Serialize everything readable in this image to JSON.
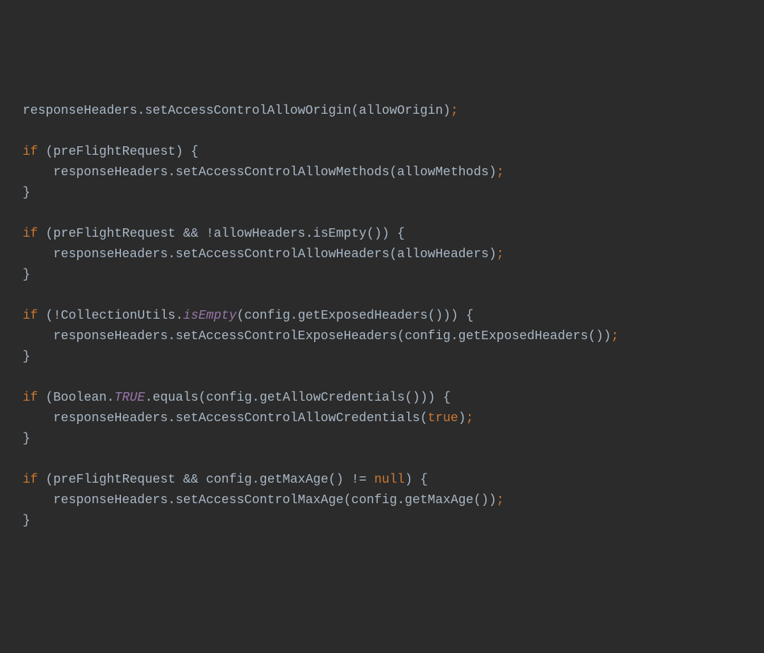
{
  "code": {
    "l1": {
      "responseHeaders": "responseHeaders",
      "dot1": ".",
      "setAccessControlAllowOrigin": "setAccessControlAllowOrigin",
      "op": "(",
      "allowOrigin": "allowOrigin",
      "cp": ")",
      "sc": ";"
    },
    "l3": {
      "if": "if",
      "sp": " ",
      "op": "(",
      "preFlightRequest": "preFlightRequest",
      "cp": ")",
      "sp2": " ",
      "ob": "{"
    },
    "l4": {
      "indent": "    ",
      "responseHeaders": "responseHeaders",
      "dot": ".",
      "setAccessControlAllowMethods": "setAccessControlAllowMethods",
      "op": "(",
      "allowMethods": "allowMethods",
      "cp": ")",
      "sc": ";"
    },
    "l5": {
      "cb": "}"
    },
    "l7": {
      "if": "if",
      "sp": " ",
      "op": "(",
      "preFlightRequest": "preFlightRequest",
      "sp2": " ",
      "andand": "&&",
      "sp3": " ",
      "bang": "!",
      "allowHeaders": "allowHeaders",
      "dot": ".",
      "isEmpty": "isEmpty",
      "op2": "(",
      "cp2": ")",
      "cp": ")",
      "sp4": " ",
      "ob": "{"
    },
    "l8": {
      "indent": "    ",
      "responseHeaders": "responseHeaders",
      "dot": ".",
      "setAccessControlAllowHeaders": "setAccessControlAllowHeaders",
      "op": "(",
      "allowHeaders": "allowHeaders",
      "cp": ")",
      "sc": ";"
    },
    "l9": {
      "cb": "}"
    },
    "l11": {
      "if": "if",
      "sp": " ",
      "op": "(",
      "bang": "!",
      "CollectionUtils": "CollectionUtils",
      "dot": ".",
      "isEmpty": "isEmpty",
      "op2": "(",
      "config": "config",
      "dot2": ".",
      "getExposedHeaders": "getExposedHeaders",
      "op3": "(",
      "cp3": ")",
      "cp2": ")",
      "cp": ")",
      "sp2": " ",
      "ob": "{"
    },
    "l12": {
      "indent": "    ",
      "responseHeaders": "responseHeaders",
      "dot": ".",
      "setAccessControlExposeHeaders": "setAccessControlExposeHeaders",
      "op": "(",
      "config": "config",
      "dot2": ".",
      "getExposedHeaders": "getExposedHeaders",
      "op2": "(",
      "cp2": ")",
      "cp": ")",
      "sc": ";"
    },
    "l13": {
      "cb": "}"
    },
    "l15": {
      "if": "if",
      "sp": " ",
      "op": "(",
      "Boolean": "Boolean",
      "dot": ".",
      "TRUE": "TRUE",
      "dot2": ".",
      "equals": "equals",
      "op2": "(",
      "config": "config",
      "dot3": ".",
      "getAllowCredentials": "getAllowCredentials",
      "op3": "(",
      "cp3": ")",
      "cp2": ")",
      "cp": ")",
      "sp2": " ",
      "ob": "{"
    },
    "l16": {
      "indent": "    ",
      "responseHeaders": "responseHeaders",
      "dot": ".",
      "setAccessControlAllowCredentials": "setAccessControlAllowCredentials",
      "op": "(",
      "true": "true",
      "cp": ")",
      "sc": ";"
    },
    "l17": {
      "cb": "}"
    },
    "l19": {
      "if": "if",
      "sp": " ",
      "op": "(",
      "preFlightRequest": "preFlightRequest",
      "sp2": " ",
      "andand": "&&",
      "sp3": " ",
      "config": "config",
      "dot": ".",
      "getMaxAge": "getMaxAge",
      "op2": "(",
      "cp2": ")",
      "sp4": " ",
      "neq": "!=",
      "sp5": " ",
      "null": "null",
      "cp": ")",
      "sp6": " ",
      "ob": "{"
    },
    "l20": {
      "indent": "    ",
      "responseHeaders": "responseHeaders",
      "dot": ".",
      "setAccessControlMaxAge": "setAccessControlMaxAge",
      "op": "(",
      "config": "config",
      "dot2": ".",
      "getMaxAge": "getMaxAge",
      "op2": "(",
      "cp2": ")",
      "cp": ")",
      "sc": ";"
    },
    "l21": {
      "cb": "}"
    }
  }
}
